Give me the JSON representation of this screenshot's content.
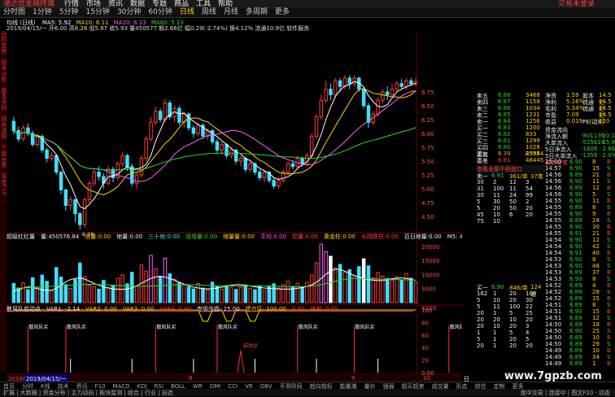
{
  "titlebar": {
    "app": "通达信金融终端",
    "menus": [
      "行情",
      "市场",
      "资讯",
      "数据",
      "专题",
      "商品",
      "工具",
      "帮助"
    ],
    "right_text": "交易未登录"
  },
  "menubar": {
    "items": [
      "分时图",
      "1分钟",
      "5分钟",
      "15分钟",
      "30分钟",
      "60分钟",
      "日线",
      "周线",
      "月线",
      "多周期",
      "更多"
    ]
  },
  "info": {
    "line1_name": "均线 (日线)",
    "ma5": "MA5: 5.92",
    "ma10": "MA10: 6.11",
    "ma20": "MA20: 6.13",
    "ma60": "MA60: 5.23",
    "line2": "2019/04/15/一  开6.00  高6.26  低5.87  收5.93  量450577  额2.66亿  幅0.29(-2.74%)  换4.12%  流通10.9亿  软件服务"
  },
  "price_axis": [
    "6.75",
    "6.50",
    "6.25",
    "6.00",
    "5.75",
    "5.50",
    "5.25",
    "5.00",
    "4.75",
    "4.50"
  ],
  "low_label": "4.26",
  "left_strip": [
    "分时走势",
    "技术分析",
    "基本资料",
    "财务透视",
    "个股全景",
    "深度F10"
  ],
  "vol_panel": {
    "title": "超级红红量",
    "fields": [
      {
        "label": "量:450576.84",
        "cls": "white"
      },
      {
        "label": "倍量:0.00",
        "cls": "yellow"
      },
      {
        "label": "地量:0.00",
        "cls": "white"
      },
      {
        "label": "三十地:0.00",
        "cls": "cyan"
      },
      {
        "label": "倍增量:0.00",
        "cls": "green"
      },
      {
        "label": "缩量量:0.00",
        "cls": "yellow"
      },
      {
        "label": "平均:0.00",
        "cls": "mag"
      },
      {
        "label": "控量:0.00",
        "cls": "red"
      },
      {
        "label": "黄金柱:0.00",
        "cls": "yellow"
      },
      {
        "label": "长阴跌柱:0.00",
        "cls": "red"
      },
      {
        "label": "百日地量:0.00",
        "cls": "white"
      },
      {
        "label": "M5: 453632.03",
        "cls": "white"
      },
      {
        "label": "M20: 770702.25",
        "cls": "white"
      },
      {
        "label": "M60: 567105.63",
        "cls": "yellow"
      }
    ],
    "axis": [
      "20000",
      "15000",
      "10000",
      "5000",
      "X100"
    ],
    "m5": [
      4200,
      4500,
      5200,
      5600,
      5400,
      5000,
      4600,
      4300,
      4400,
      5100,
      6200,
      7400,
      8200,
      8600,
      8800,
      8400,
      7600,
      6800,
      6200,
      5600,
      5200,
      4900,
      4800,
      4700,
      4900,
      5300,
      6000,
      6900,
      7800,
      8600,
      9200,
      9400,
      9100,
      8600,
      8000,
      7300,
      6600,
      6000,
      5500,
      5200,
      5000,
      4900,
      5000,
      5200,
      5500,
      5900,
      6200,
      6400,
      6400,
      6200,
      5900,
      5600,
      5400,
      5200,
      5100,
      5000,
      4900,
      4800,
      4800,
      4900,
      5100,
      5400,
      5800,
      6300,
      7200,
      8600,
      10100,
      11300,
      11900,
      11800,
      11200,
      10400,
      9700,
      9000,
      8600,
      8200,
      8000,
      7800,
      7900,
      8200,
      8500,
      8700,
      8800,
      8600,
      8300,
      7900
    ],
    "m20": [
      5000,
      5100,
      5200,
      5300,
      5400,
      5500,
      5600,
      5700,
      5800,
      5900,
      6000,
      6100,
      6200,
      6300,
      6400,
      6450,
      6500,
      6500,
      6450,
      6400,
      6300,
      6200,
      6100,
      6000,
      5900,
      5850,
      5800,
      5800,
      5850,
      5900,
      5950,
      6000,
      6100,
      6200,
      6300,
      6350,
      6400,
      6400,
      6350,
      6300,
      6200,
      6100,
      6000,
      5950,
      5900,
      5900,
      5900,
      5900,
      5900,
      5900,
      5950,
      6000,
      6000,
      5950,
      5900,
      5850,
      5800,
      5750,
      5700,
      5650,
      5650,
      5700,
      5800,
      5900,
      6100,
      6400,
      6800,
      7200,
      7600,
      8000,
      8300,
      8500,
      8600,
      8600,
      8550,
      8500,
      8450,
      8400,
      8350,
      8300,
      8250,
      8200,
      8150,
      8100,
      8050,
      8000
    ]
  },
  "ind_panel": {
    "title": "散风队启动点",
    "fields": [
      {
        "label": "VAR1: -2.14",
        "cls": "white"
      },
      {
        "label": "VAR2: 0.00",
        "cls": "yellow"
      },
      {
        "label": "VAR3: 0.00",
        "cls": "yellow"
      },
      {
        "label": "VAR4: 0.00",
        "cls": "red"
      },
      {
        "label": "专吸庄盘: 25.00",
        "cls": "white"
      },
      {
        "label": "建仓区: 100.00",
        "cls": "yellow"
      },
      {
        "label": "0.00",
        "cls": "red"
      },
      {
        "label": "底部: 0.00",
        "cls": "red"
      }
    ],
    "axis": [
      "100",
      "80",
      "60",
      "40",
      "20",
      "0.00"
    ],
    "signal_label": "散风队买",
    "start_label": "启动点",
    "signals": [
      3,
      11,
      30,
      43,
      60,
      72,
      92,
      97
    ],
    "start_at": 48
  },
  "time_axis": {
    "date_left": "2019年",
    "date_sel": "2019/04/15/一",
    "months": [
      "8",
      "9",
      "10"
    ],
    "right": "日线"
  },
  "quote": {
    "sell": [
      [
        "卖五",
        "6.88",
        "3468"
      ],
      [
        "卖四",
        "6.87",
        "1158"
      ],
      [
        "卖三",
        "6.86",
        "1034"
      ],
      [
        "卖二",
        "6.85",
        "1231"
      ],
      [
        "卖一",
        "6.84",
        "1256"
      ]
    ],
    "buy": [
      [
        "买一",
        "6.83",
        "1200"
      ],
      [
        "买二",
        "6.82",
        "833"
      ],
      [
        "买三",
        "6.81",
        "1299"
      ],
      [
        "买四",
        "6.80",
        "1028"
      ],
      [
        "买五",
        "6.79",
        "2395"
      ]
    ],
    "diff": [
      [
        "委比",
        "7.33",
        "85544"
      ],
      [
        "委差",
        "6.81",
        "48445"
      ]
    ],
    "right": [
      [
        "净资",
        "1.59",
        "股本",
        "14.5亿"
      ],
      [
        "净利",
        "5.16%",
        "流通",
        "14.5亿"
      ],
      [
        "毛利",
        "5.34%",
        "流通",
        "14.5亿"
      ],
      [
        "市盈",
        "7.09",
        "",
        "14.5亿"
      ],
      [
        "收益",
        "0.019",
        "PE(动)",
        "120"
      ]
    ],
    "flows": [
      [
        "净流入额",
        "-801135",
        "-20.1%"
      ],
      [
        "大单流入",
        "-525613",
        "-15.8%"
      ],
      [
        "5日净流入",
        "-1606",
        "-2.66%"
      ],
      [
        "5日大单流入",
        "-1356",
        "-2.0%"
      ]
    ],
    "flows_title": "资金流向",
    "bigorder": "最新逐笔",
    "link": "查看全部千档盘口",
    "sellhead": [
      "卖一",
      "6.91",
      "361/单",
      "37笔"
    ],
    "book1": [
      [
        "30",
        "2",
        "12",
        "3"
      ],
      [
        "31",
        "100",
        "11",
        "54"
      ],
      [
        "30",
        "11",
        "24",
        "99"
      ],
      [
        "5",
        "30",
        "50",
        "2"
      ],
      [
        "5",
        "20",
        "50",
        "20"
      ],
      [
        "45",
        "10",
        "6",
        "20"
      ],
      [
        "75",
        "10",
        "",
        ""
      ]
    ],
    "buyhead": [
      "买一",
      "6.90",
      "846/单",
      "124笔"
    ],
    "book2": [
      [
        "162",
        "1",
        "20",
        "100"
      ],
      [
        "5",
        "10",
        "20",
        "30"
      ],
      [
        "5",
        "11",
        "100",
        "22"
      ],
      [
        "20",
        "1",
        "5",
        "25"
      ],
      [
        "20",
        "20",
        "10",
        "20"
      ],
      [
        "20",
        "10",
        "20",
        "3"
      ],
      [
        "1",
        "1",
        "5",
        "4"
      ],
      [
        "5",
        "1",
        "20",
        "5"
      ],
      [
        "20",
        "1",
        "20",
        "20"
      ]
    ],
    "ticks_time": [
      "15:00",
      "14:57",
      "14:56",
      "14:56",
      "14:56",
      "14:56",
      "14:55",
      "14:55",
      "14:55",
      "14:55",
      "14:55",
      "14:55",
      "14:54",
      "14:54",
      "14:54",
      "14:53",
      "14:53",
      "14:53",
      "14:53",
      "14:52",
      "14:52",
      "14:52",
      "14:51",
      "14:51",
      "14:51",
      "14:50",
      "14:50",
      "14:50",
      "14:50",
      "14:49",
      "14:49",
      "14:49"
    ],
    "ticks_price": [
      "6.90",
      "6.90",
      "6.89",
      "6.90",
      "6.89",
      "6.90",
      "6.90",
      "6.89",
      "6.90",
      "6.89",
      "6.90",
      "6.91",
      "6.90",
      "6.90",
      "6.91",
      "6.90",
      "6.90",
      "6.89",
      "6.90",
      "6.89",
      "6.89",
      "6.89",
      "6.89",
      "6.90",
      "6.89",
      "6.89",
      "6.90",
      "6.89",
      "6.89",
      "6.89",
      "6.89",
      "6.89"
    ],
    "ticks_vol": [
      "8",
      "15",
      "21",
      "11",
      "12",
      "5",
      "11",
      "8",
      "9",
      "24",
      "30",
      "21",
      "12",
      "42",
      "40",
      "8",
      "48",
      "37",
      "8",
      "4",
      "28",
      "15",
      "8",
      "15",
      "12",
      "18",
      "25",
      "10",
      "29",
      "10",
      "34",
      "1"
    ],
    "ticks_side": [
      "B",
      "S",
      "B",
      "S",
      "B",
      "S",
      "B",
      "S",
      "B",
      "S",
      "B",
      "B",
      "S",
      "S",
      "B",
      "S",
      "S",
      "B",
      "S",
      "B",
      "S",
      "B",
      "S",
      "B",
      "S",
      "B",
      "S",
      "B",
      "S",
      "B",
      "S",
      "B"
    ]
  },
  "tabs": [
    "首页",
    "分时",
    "K线",
    "技术",
    "资讯",
    "F10",
    "MACD",
    "KDJ",
    "RSI",
    "BOLL",
    "WR",
    "DMI",
    "CCI",
    "VR",
    "OBV",
    "平滑异同",
    "趋向指标",
    "能量潮",
    "量价",
    "强弱",
    "超买超卖",
    "成交量",
    "形态",
    "综合",
    "定制",
    "更多"
  ],
  "status": {
    "left": "扩展 | 大数据 | 资金分布 | 主力动向 | 板块监测 | 综合 | 行业 | 自选",
    "right": "盘中交易 | 连接中 | 图文F10 · 动态"
  },
  "watermark": "www.7gpzb.com",
  "colors": {
    "up": "#ff3b3b",
    "down": "#3fe0ff",
    "ma5": "#ffffff",
    "ma10": "#ffd300",
    "ma20": "#ff5fff",
    "ma60": "#2ed82e",
    "vol_m20": "#2ed82e"
  },
  "chart_data": {
    "type": "candlestick",
    "title": "",
    "ylim": [
      4.0,
      7.0
    ],
    "candles": [
      [
        6.22,
        6.05,
        6.3,
        5.98
      ],
      [
        6.05,
        5.9,
        6.12,
        5.85
      ],
      [
        5.9,
        6.1,
        6.15,
        5.86
      ],
      [
        6.1,
        6.0,
        6.18,
        5.95
      ],
      [
        6.0,
        5.8,
        6.05,
        5.76
      ],
      [
        5.8,
        5.95,
        6.0,
        5.75
      ],
      [
        5.95,
        5.7,
        5.98,
        5.65
      ],
      [
        5.7,
        5.55,
        5.74,
        5.48
      ],
      [
        5.55,
        5.6,
        5.66,
        5.5
      ],
      [
        5.6,
        5.3,
        5.62,
        5.25
      ],
      [
        5.3,
        4.98,
        5.32,
        4.9
      ],
      [
        4.98,
        4.7,
        5.0,
        4.6
      ],
      [
        4.7,
        4.8,
        4.86,
        4.62
      ],
      [
        4.8,
        4.55,
        4.82,
        4.4
      ],
      [
        4.55,
        4.35,
        4.58,
        4.26
      ],
      [
        4.35,
        4.8,
        4.85,
        4.3
      ],
      [
        4.8,
        5.1,
        5.15,
        4.75
      ],
      [
        5.1,
        5.3,
        5.36,
        5.05
      ],
      [
        5.3,
        5.22,
        5.4,
        5.15
      ],
      [
        5.22,
        5.1,
        5.28,
        5.0
      ],
      [
        5.1,
        5.35,
        5.42,
        5.06
      ],
      [
        5.35,
        5.2,
        5.4,
        5.12
      ],
      [
        5.2,
        5.45,
        5.5,
        5.15
      ],
      [
        5.45,
        5.6,
        5.66,
        5.4
      ],
      [
        5.6,
        5.4,
        5.63,
        5.32
      ],
      [
        5.4,
        5.1,
        5.45,
        5.05
      ],
      [
        5.1,
        5.25,
        5.3,
        5.0
      ],
      [
        5.25,
        5.55,
        5.6,
        5.2
      ],
      [
        5.55,
        5.9,
        5.95,
        5.5
      ],
      [
        5.9,
        6.2,
        6.3,
        5.85
      ],
      [
        6.2,
        6.4,
        6.48,
        6.15
      ],
      [
        6.4,
        6.25,
        6.45,
        6.2
      ],
      [
        6.25,
        6.55,
        6.62,
        6.2
      ],
      [
        6.55,
        6.3,
        6.6,
        6.25
      ],
      [
        6.3,
        6.45,
        6.5,
        6.2
      ],
      [
        6.45,
        6.2,
        6.5,
        6.15
      ],
      [
        6.2,
        6.35,
        6.4,
        6.1
      ],
      [
        6.35,
        6.1,
        6.38,
        6.05
      ],
      [
        6.1,
        6.0,
        6.15,
        5.92
      ],
      [
        6.0,
        6.15,
        6.2,
        5.95
      ],
      [
        6.15,
        5.95,
        6.18,
        5.9
      ],
      [
        5.95,
        6.05,
        6.1,
        5.88
      ],
      [
        6.05,
        5.85,
        6.08,
        5.8
      ],
      [
        5.85,
        5.7,
        5.9,
        5.65
      ],
      [
        5.7,
        5.8,
        5.85,
        5.62
      ],
      [
        5.8,
        5.6,
        5.82,
        5.55
      ],
      [
        5.6,
        5.7,
        5.75,
        5.55
      ],
      [
        5.7,
        5.5,
        5.72,
        5.45
      ],
      [
        5.5,
        5.55,
        5.6,
        5.4
      ],
      [
        5.55,
        5.35,
        5.58,
        5.3
      ],
      [
        5.35,
        5.45,
        5.5,
        5.3
      ],
      [
        5.45,
        5.3,
        5.48,
        5.25
      ],
      [
        5.3,
        5.2,
        5.35,
        5.15
      ],
      [
        5.2,
        5.3,
        5.34,
        5.12
      ],
      [
        5.3,
        5.15,
        5.32,
        5.1
      ],
      [
        5.15,
        5.05,
        5.2,
        5.0
      ],
      [
        5.05,
        5.15,
        5.2,
        5.0
      ],
      [
        5.15,
        5.3,
        5.35,
        5.1
      ],
      [
        5.3,
        5.45,
        5.5,
        5.25
      ],
      [
        5.45,
        5.4,
        5.52,
        5.35
      ],
      [
        5.4,
        5.55,
        5.6,
        5.35
      ],
      [
        5.55,
        5.45,
        5.58,
        5.4
      ],
      [
        5.45,
        5.6,
        5.65,
        5.42
      ],
      [
        5.6,
        5.95,
        6.0,
        5.55
      ],
      [
        5.95,
        6.3,
        6.35,
        5.9
      ],
      [
        6.3,
        6.6,
        6.7,
        6.25
      ],
      [
        6.6,
        6.8,
        6.95,
        6.55
      ],
      [
        6.8,
        6.7,
        6.9,
        6.6
      ],
      [
        6.7,
        6.95,
        7.0,
        6.65
      ],
      [
        6.95,
        6.85,
        7.0,
        6.75
      ],
      [
        6.85,
        7.0,
        7.05,
        6.8
      ],
      [
        7.0,
        6.9,
        7.05,
        6.8
      ],
      [
        6.9,
        7.0,
        7.05,
        6.85
      ],
      [
        7.0,
        6.8,
        7.02,
        6.75
      ],
      [
        6.8,
        6.5,
        6.85,
        6.45
      ],
      [
        6.5,
        6.2,
        6.55,
        6.1
      ],
      [
        6.2,
        6.35,
        6.4,
        6.15
      ],
      [
        6.35,
        6.6,
        6.65,
        6.3
      ],
      [
        6.6,
        6.75,
        6.8,
        6.55
      ],
      [
        6.75,
        6.7,
        6.85,
        6.6
      ],
      [
        6.7,
        6.8,
        6.9,
        6.65
      ],
      [
        6.8,
        6.9,
        6.95,
        6.75
      ],
      [
        6.9,
        6.85,
        6.98,
        6.8
      ],
      [
        6.85,
        6.95,
        7.0,
        6.8
      ],
      [
        6.95,
        6.9,
        7.0,
        6.85
      ],
      [
        6.9,
        6.93,
        7.0,
        6.85
      ]
    ],
    "volume": [
      6800,
      5200,
      7100,
      4600,
      8900,
      5600,
      9800,
      7600,
      4300,
      12500,
      9100,
      6400,
      5100,
      8200,
      14100,
      9300,
      6200,
      5700,
      4800,
      7900,
      5400,
      6100,
      8700,
      9900,
      6700,
      10800,
      5900,
      13400,
      11200,
      16800,
      12100,
      9400,
      15800,
      10300,
      8400,
      7100,
      6300,
      5600,
      4900,
      6800,
      5200,
      4600,
      7300,
      5900,
      4800,
      6100,
      5300,
      4700,
      5500,
      6200,
      5100,
      4600,
      5800,
      4400,
      5900,
      6700,
      5200,
      6400,
      7600,
      5800,
      6900,
      5500,
      7200,
      9800,
      14200,
      20800,
      18200,
      16500,
      12400,
      13600,
      10900,
      11700,
      9500,
      12800,
      15600,
      13100,
      8800,
      10700,
      9400,
      8600,
      7900,
      9200,
      8100,
      10400,
      8700,
      7300
    ]
  }
}
